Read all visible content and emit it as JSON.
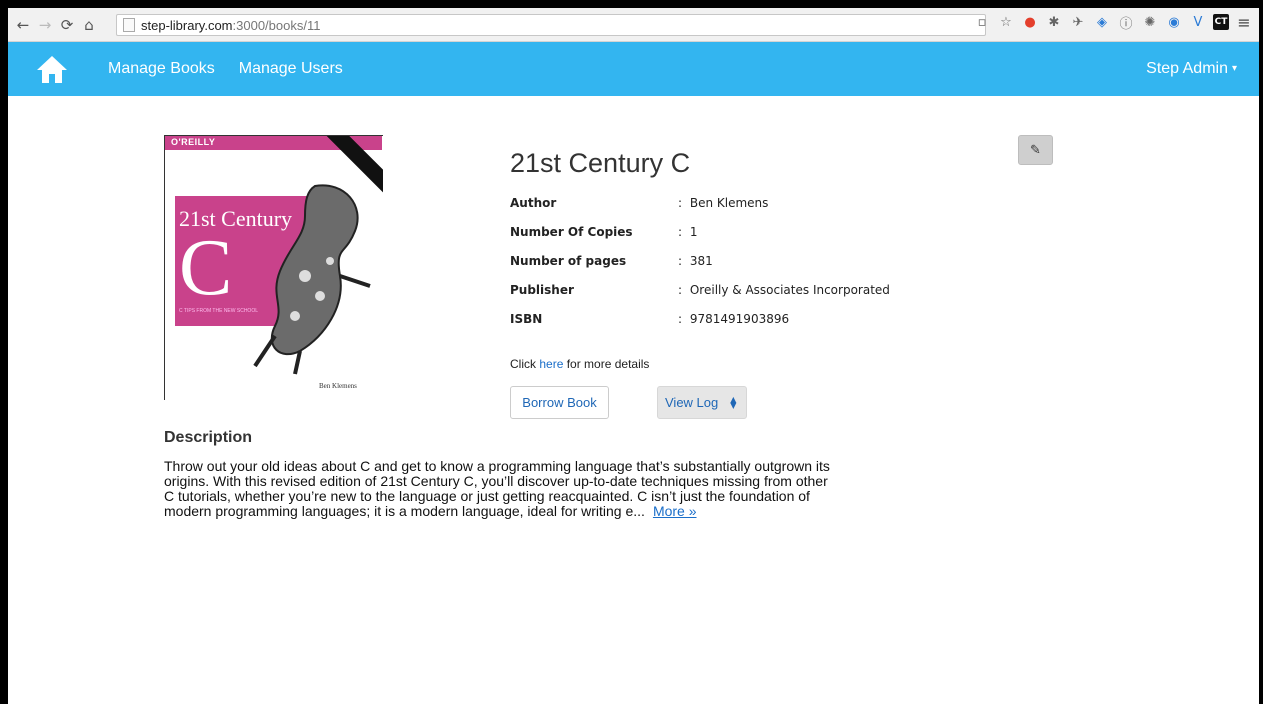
{
  "browser": {
    "url_host": "step-library.com",
    "url_path": ":3000/books/11",
    "extensions": [
      "page-action-icon",
      "star-icon",
      "opera-icon",
      "puzzle-icon",
      "rocket-icon",
      "shield-icon",
      "info-icon",
      "sun-icon",
      "chrome-icon",
      "v-icon",
      "ct-icon",
      "menu-icon"
    ],
    "ct_label": "CT"
  },
  "navbar": {
    "bg_color": "#33b5f0",
    "links": [
      "Manage Books",
      "Manage Users"
    ],
    "user": "Step Admin"
  },
  "book": {
    "cover": {
      "brand": "O'REILLY",
      "title_line": "21st Century",
      "big_letter": "C",
      "subtitle": "C TIPS FROM THE NEW SCHOOL",
      "author": "Ben Klemens"
    },
    "title": "21st Century C",
    "details": [
      {
        "label": "Author",
        "value": "Ben Klemens"
      },
      {
        "label": "Number Of Copies",
        "value": "1"
      },
      {
        "label": "Number of pages",
        "value": "381"
      },
      {
        "label": "Publisher",
        "value": "Oreilly & Associates Incorporated"
      },
      {
        "label": "ISBN",
        "value": "9781491903896"
      }
    ],
    "more_prefix": "Click ",
    "more_link": "here",
    "more_suffix": " for more details",
    "borrow_label": "Borrow Book",
    "view_log_label": "View Log",
    "description_heading": "Description",
    "description": "Throw out your old ideas about C and get to know a programming language that’s substantially outgrown its origins. With this revised edition of 21st Century C, you’ll discover up-to-date techniques missing from other C tutorials, whether you’re new to the language or just getting reacquainted. C isn’t just the foundation of modern programming languages; it is a modern language, ideal for writing e...",
    "description_more": "More »"
  }
}
